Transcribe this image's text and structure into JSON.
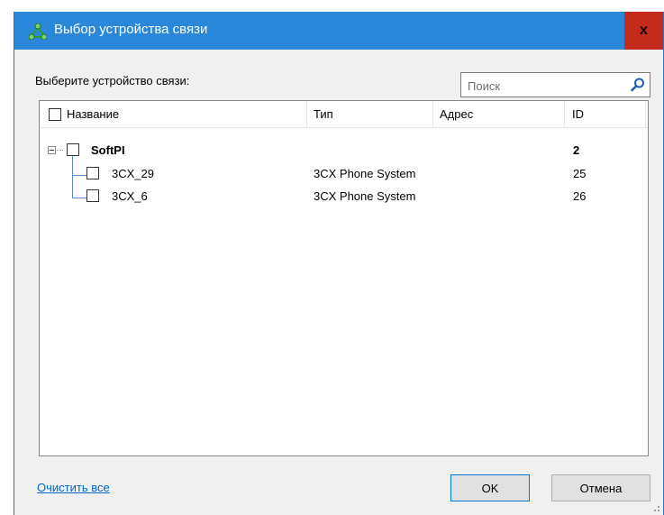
{
  "window": {
    "title": "Выбор устройства связи",
    "close_label": "x"
  },
  "prompt": "Выберите устройство связи:",
  "search": {
    "placeholder": "Поиск",
    "value": ""
  },
  "columns": [
    "Название",
    "Тип",
    "Адрес",
    "ID"
  ],
  "tree": {
    "root": {
      "name": "SoftPI",
      "type": "",
      "address": "",
      "id": "2"
    },
    "children": [
      {
        "name": "3CX_29",
        "type": "3CX Phone System",
        "address": "",
        "id": "25"
      },
      {
        "name": "3CX_6",
        "type": "3CX Phone System",
        "address": "",
        "id": "26"
      }
    ]
  },
  "footer": {
    "clear_all_label": "Очистить все",
    "ok_label": "OK",
    "cancel_label": "Отмена"
  },
  "colors": {
    "titlebar": "#2b87da",
    "close": "#c42b1c",
    "link": "#0066cc"
  },
  "icons": {
    "app": "network-nodes-icon",
    "search": "magnifier-icon"
  }
}
